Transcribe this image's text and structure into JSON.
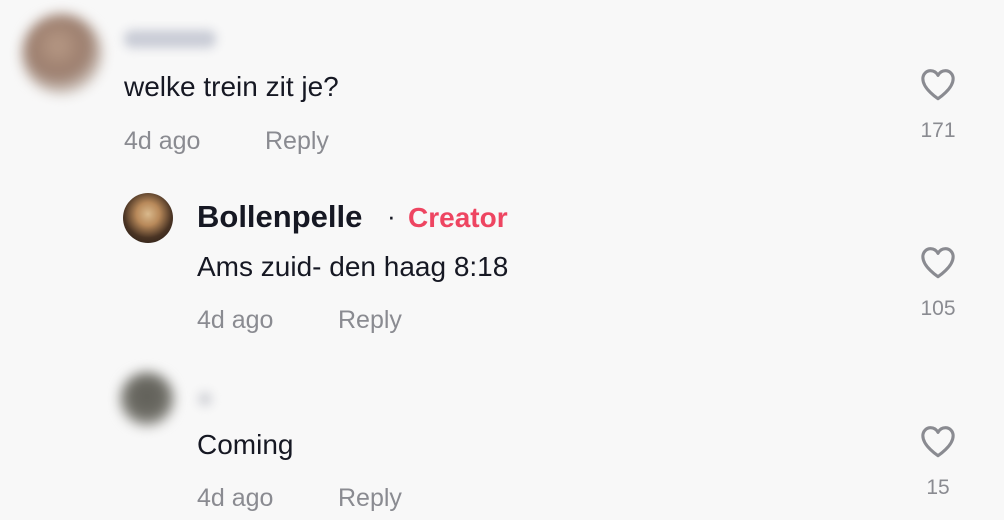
{
  "comments": [
    {
      "text": "welke trein zit je?",
      "time": "4d ago",
      "reply_label": "Reply",
      "likes": "171"
    },
    {
      "username": "Bollenpelle",
      "separator": "·",
      "badge": "Creator",
      "text": "Ams zuid- den haag 8:18",
      "time": "4d ago",
      "reply_label": "Reply",
      "likes": "105"
    },
    {
      "text": "Coming",
      "time": "4d ago",
      "reply_label": "Reply",
      "likes": "15"
    }
  ],
  "colors": {
    "creator_accent": "#ee4561",
    "text_primary": "#161823",
    "text_secondary": "#8a8b91",
    "background": "#f8f8f8"
  },
  "icons": {
    "like": "heart-outline-icon"
  }
}
